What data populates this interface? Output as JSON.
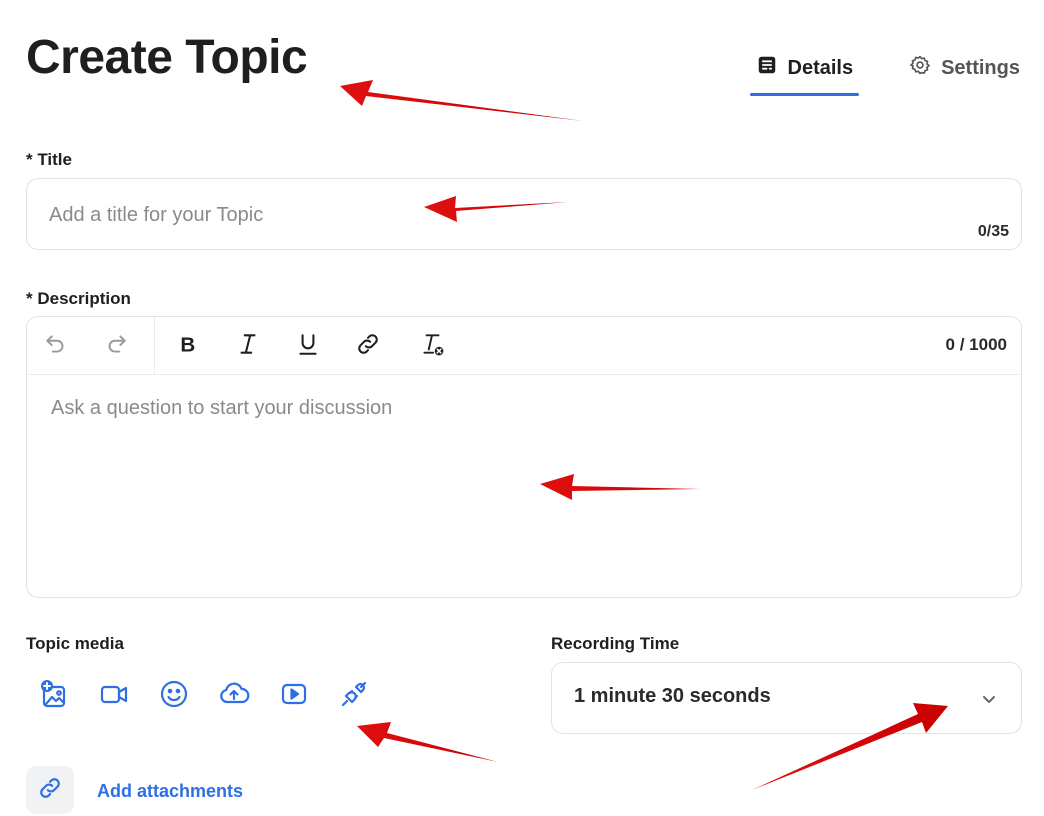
{
  "header": {
    "title": "Create Topic",
    "tabs": [
      {
        "label": "Details",
        "icon": "form-icon",
        "active": true
      },
      {
        "label": "Settings",
        "icon": "gear-icon",
        "active": false
      }
    ]
  },
  "title_field": {
    "label": "* Title",
    "placeholder": "Add a title for your Topic",
    "value": "",
    "counter": "0/35"
  },
  "description_field": {
    "label": "* Description",
    "placeholder": "Ask a question to start your discussion",
    "value": "",
    "counter": "0 / 1000",
    "toolbar": [
      "undo-icon",
      "redo-icon",
      "bold-icon",
      "italic-icon",
      "underline-icon",
      "link-icon",
      "clear-format-icon"
    ]
  },
  "topic_media": {
    "label": "Topic media",
    "icons": [
      "add-image-icon",
      "video-camera-icon",
      "emoji-icon",
      "cloud-upload-icon",
      "play-video-icon",
      "plug-connect-icon"
    ]
  },
  "recording_time": {
    "label": "Recording Time",
    "selected": "1 minute 30 seconds"
  },
  "attachments": {
    "label": "Add attachments",
    "icon": "link-icon"
  },
  "colors": {
    "accent": "#2f6fe4",
    "annotation_arrow": "#e01010",
    "border": "#e3e3e3",
    "placeholder": "#8a8a8a"
  }
}
